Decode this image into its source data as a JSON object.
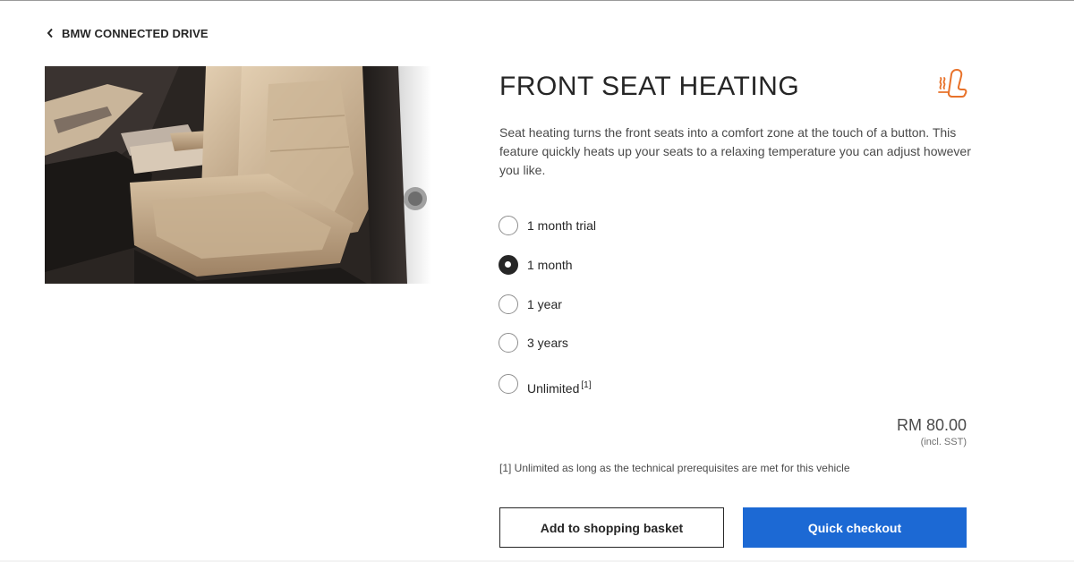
{
  "nav": {
    "back_label": "BMW CONNECTED DRIVE"
  },
  "product": {
    "title": "FRONT SEAT HEATING",
    "icon": "heated-seat-icon",
    "description": "Seat heating turns the front seats into a comfort zone at the touch of a button. This feature quickly heats up your seats to a relaxing temperature you can adjust however you like."
  },
  "options": [
    {
      "label": "1 month trial",
      "selected": false
    },
    {
      "label": "1 month",
      "selected": true
    },
    {
      "label": "1 year",
      "selected": false
    },
    {
      "label": "3 years",
      "selected": false
    },
    {
      "label": "Unlimited",
      "footnote_ref": "[1]",
      "selected": false
    }
  ],
  "price": {
    "amount": "RM 80.00",
    "tax_note": "(incl. SST)"
  },
  "footnote": "[1] Unlimited as long as the technical prerequisites are met for this vehicle",
  "actions": {
    "add_to_basket": "Add to shopping basket",
    "quick_checkout": "Quick checkout"
  },
  "colors": {
    "accent_blue": "#1c69d4",
    "icon_orange": "#e8722a",
    "text_dark": "#262626"
  }
}
